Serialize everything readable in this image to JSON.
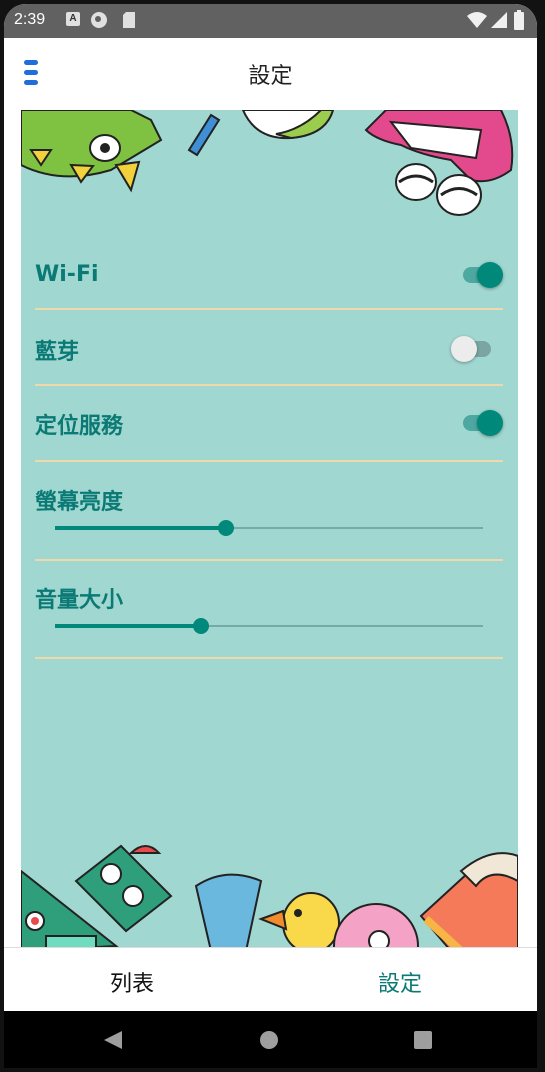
{
  "status_bar": {
    "time": "2:39",
    "left_icons": [
      "a-notification-icon",
      "circle-app-icon",
      "sd-card-icon"
    ],
    "right_icons": [
      "wifi-icon",
      "cellular-signal-icon",
      "battery-icon"
    ]
  },
  "app_bar": {
    "title": "設定",
    "menu_icon": "hamburger-menu-icon",
    "accent_color": "#1e6fd9"
  },
  "settings": {
    "wifi": {
      "label": "Wi-Fi",
      "enabled": true
    },
    "bluetooth": {
      "label": "藍芽",
      "enabled": false
    },
    "location": {
      "label": "定位服務",
      "enabled": true
    },
    "brightness": {
      "label": "螢幕亮度",
      "value_fraction": 0.4
    },
    "volume": {
      "label": "音量大小",
      "value_fraction": 0.34
    }
  },
  "bottom_nav": {
    "list_label": "列表",
    "settings_label": "設定",
    "active": "settings"
  },
  "system_nav": [
    "back-icon",
    "home-icon",
    "recents-icon"
  ],
  "colors": {
    "content_background": "#a1d7d1",
    "label_teal": "#0b7a75",
    "switch_on": "#00897b",
    "divider": "#efd9a8"
  }
}
